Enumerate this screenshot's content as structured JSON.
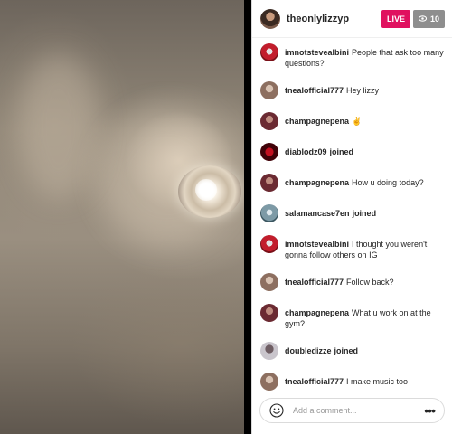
{
  "header": {
    "host_username": "theonlylizzyp",
    "live_label": "LIVE",
    "viewer_count": "10"
  },
  "comments": [
    {
      "user": "imnotsteveаlbini",
      "text": "People that ask too many questions?"
    },
    {
      "user": "tnealofficial777",
      "text": "Hey lizzy"
    },
    {
      "user": "champagnepena",
      "text": "✌"
    },
    {
      "user": "diablodz09",
      "text": "joined"
    },
    {
      "user": "champagnepena",
      "text": "How u doing today?"
    },
    {
      "user": "salamancase7en",
      "text": "joined"
    },
    {
      "user": "imnotsteveаlbini",
      "text": "I thought you weren't gonna follow others on IG"
    },
    {
      "user": "tnealofficial777",
      "text": "Follow back?"
    },
    {
      "user": "champagnepena",
      "text": "What u work on at the gym?"
    },
    {
      "user": "doubledizze",
      "text": "joined"
    },
    {
      "user": "tnealofficial777",
      "text": "I make music too"
    }
  ],
  "composer": {
    "placeholder": "Add a comment...",
    "more_label": "•••"
  },
  "colors": {
    "live_badge": "#e0115f",
    "viewer_badge": "#8e8e8e"
  },
  "icons": {
    "emoji": "smile-icon",
    "viewers": "eye-icon",
    "more": "more-icon"
  }
}
